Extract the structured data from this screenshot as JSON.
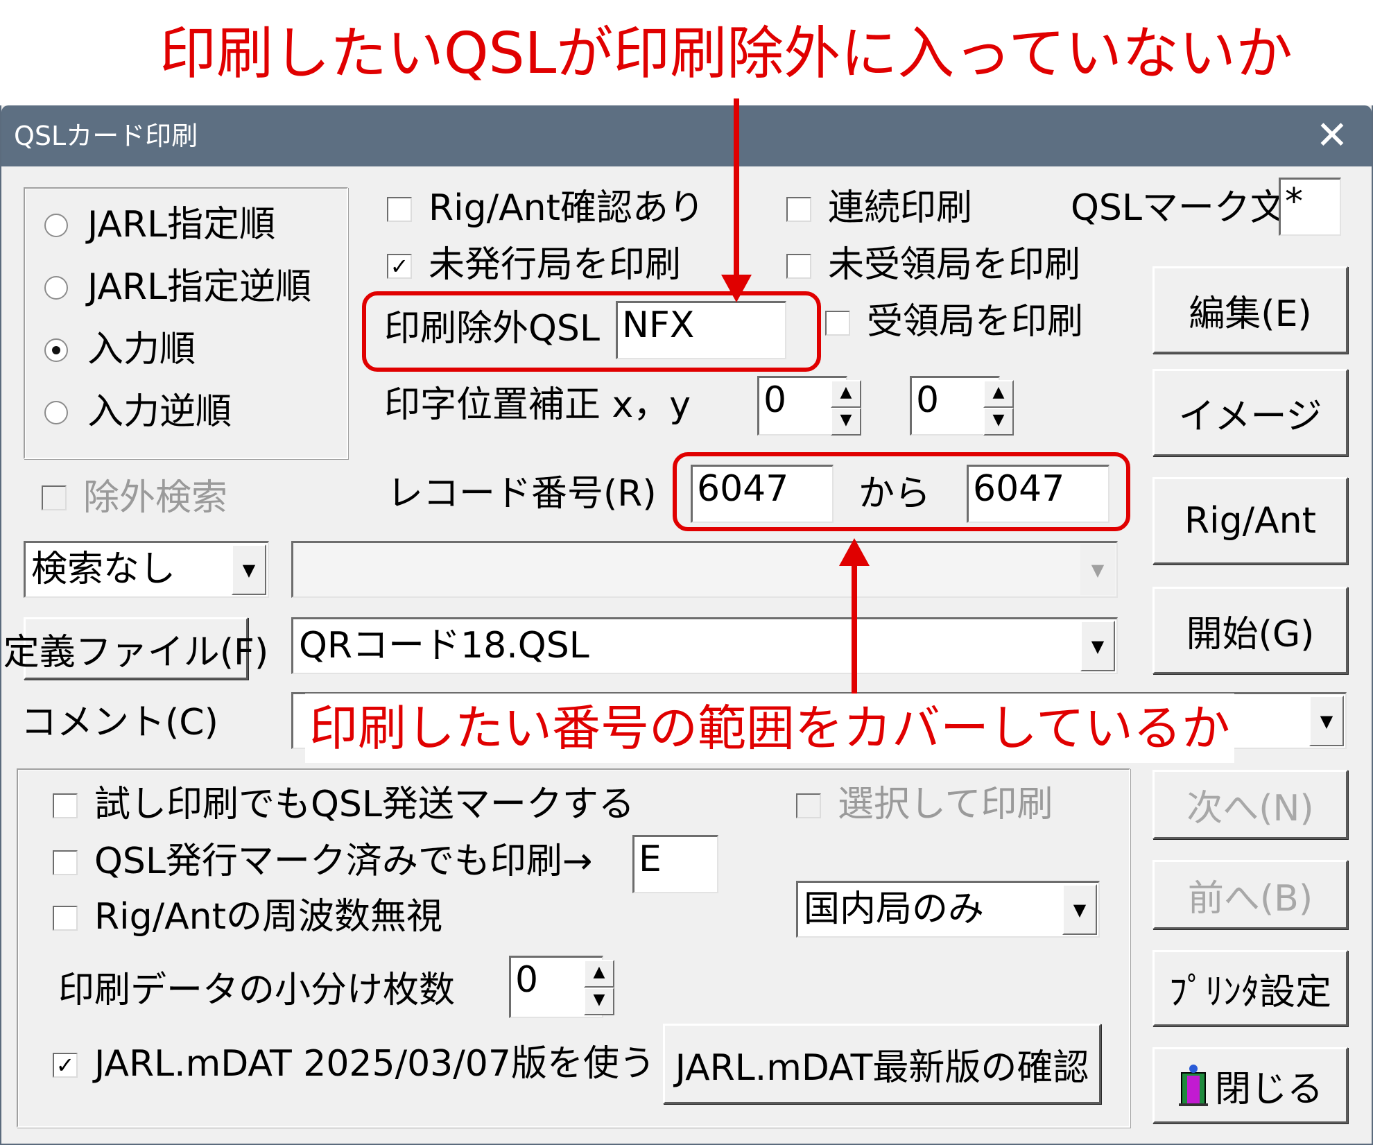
{
  "annotations": {
    "top": "印刷したいQSLが印刷除外に入っていないか",
    "bottom": "印刷したい番号の範囲をカバーしているか"
  },
  "window": {
    "title": "QSLカード印刷",
    "close": "✕"
  },
  "sort": {
    "options": [
      "JARL指定順",
      "JARL指定逆順",
      "入力順",
      "入力逆順"
    ],
    "selected": "入力順"
  },
  "checks": {
    "rig_ant_confirm": {
      "label": "Rig/Ant確認あり",
      "checked": false
    },
    "continuous_print": {
      "label": "連続印刷",
      "checked": false
    },
    "print_unissued": {
      "label": "未発行局を印刷",
      "checked": true
    },
    "print_unreceived": {
      "label": "未受領局を印刷",
      "checked": false
    },
    "print_received": {
      "label": "受領局を印刷",
      "checked": false
    },
    "exclude_search": {
      "label": "除外検索",
      "checked": false
    },
    "test_print_mark": {
      "label": "試し印刷でもQSL発送マークする",
      "checked": false
    },
    "print_even_issued": {
      "label": "QSL発行マーク済みでも印刷→",
      "checked": false
    },
    "ignore_freq": {
      "label": "Rig/Antの周波数無視",
      "checked": false
    },
    "select_print": {
      "label": "選択して印刷",
      "checked": false
    },
    "use_jarl_mdat": {
      "label": "JARL.mDAT 2025/03/07版を使う",
      "checked": true
    }
  },
  "qsl_mark": {
    "label": "QSLマーク文字",
    "value": "*"
  },
  "exclude_qsl": {
    "label": "印刷除外QSL",
    "value": "NFX"
  },
  "offset": {
    "label": "印字位置補正 x，y",
    "x": "0",
    "y": "0"
  },
  "record": {
    "label": "レコード番号(R)",
    "from": "6047",
    "kara": "から",
    "to": "6047"
  },
  "search": {
    "mode": "検索なし",
    "text": ""
  },
  "definition": {
    "button": "定義ファイル(F)",
    "file": "QRコード18.QSL"
  },
  "comment": {
    "label": "コメント(C)",
    "value": ""
  },
  "issued_mark_value": "E",
  "region": "国内局のみ",
  "split": {
    "label": "印刷データの小分け枚数",
    "value": "0"
  },
  "buttons": {
    "edit": "編集(E)",
    "image": "イメージ",
    "rig_ant": "Rig/Ant",
    "start": "開始(G)",
    "next": "次へ(N)",
    "prev": "前へ(B)",
    "printer": "ﾌﾟﾘﾝﾀ設定",
    "close": "閉じる",
    "jarl_check": "JARL.mDAT最新版の確認"
  },
  "glyphs": {
    "check": "✓",
    "up": "▲",
    "down": "▼"
  },
  "colors": {
    "annotation": "#e00000",
    "titlebar": "#5d6f82"
  }
}
